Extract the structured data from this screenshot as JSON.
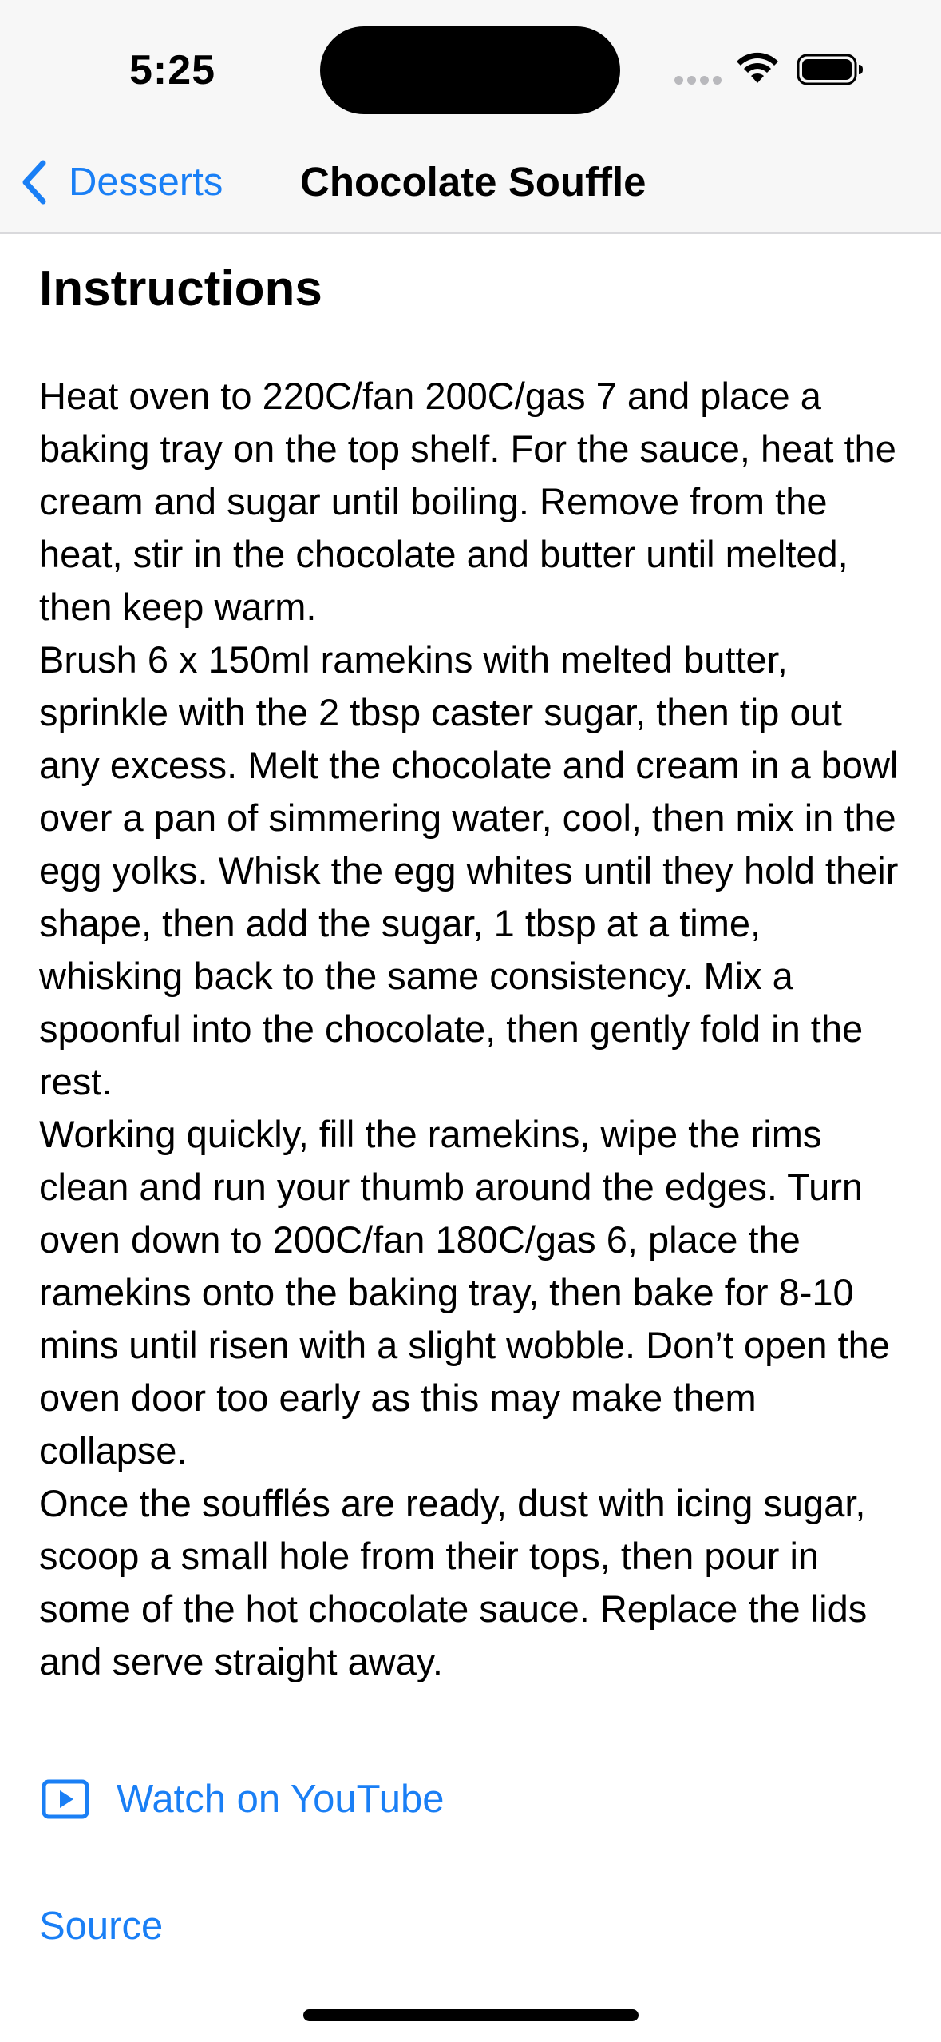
{
  "status_bar": {
    "time": "5:25",
    "icons": [
      "cellular-signal-icon",
      "wifi-icon",
      "battery-icon"
    ]
  },
  "nav": {
    "back_label": "Desserts",
    "back_icon": "chevron-left-icon",
    "title": "Chocolate Souffle"
  },
  "content": {
    "heading": "Instructions",
    "instructions": "Heat oven to 220C/fan 200C/gas 7 and place a baking tray on the top shelf. For the sauce, heat the cream and sugar until boiling. Remove from the heat, stir in the chocolate and butter until melted, then keep warm.\nBrush 6 x 150ml ramekins with melted butter, sprinkle with the 2 tbsp caster sugar, then tip out any excess. Melt the chocolate and cream in a bowl over a pan of simmering water, cool, then mix in the egg yolks. Whisk the egg whites until they hold their shape, then add the sugar, 1 tbsp at a time, whisking back to the same consistency. Mix a spoonful into the chocolate, then gently fold in the rest.\nWorking quickly, fill the ramekins, wipe the rims clean and run your thumb around the edges. Turn oven down to 200C/fan 180C/gas 6, place the ramekins onto the baking tray, then bake for 8-10 mins until risen with a slight wobble. Don’t open the oven door too early as this may make them collapse.\nOnce the soufflés are ready, dust with icing sugar, scoop a small hole from their tops, then pour in some of the hot chocolate sauce. Replace the lids and serve straight away.",
    "youtube_label": "Watch on YouTube",
    "youtube_icon": "play-rectangle-icon",
    "source_label": "Source"
  },
  "colors": {
    "accent": "#1a7ff5",
    "nav_background": "#f7f7f7",
    "text": "#000000"
  }
}
